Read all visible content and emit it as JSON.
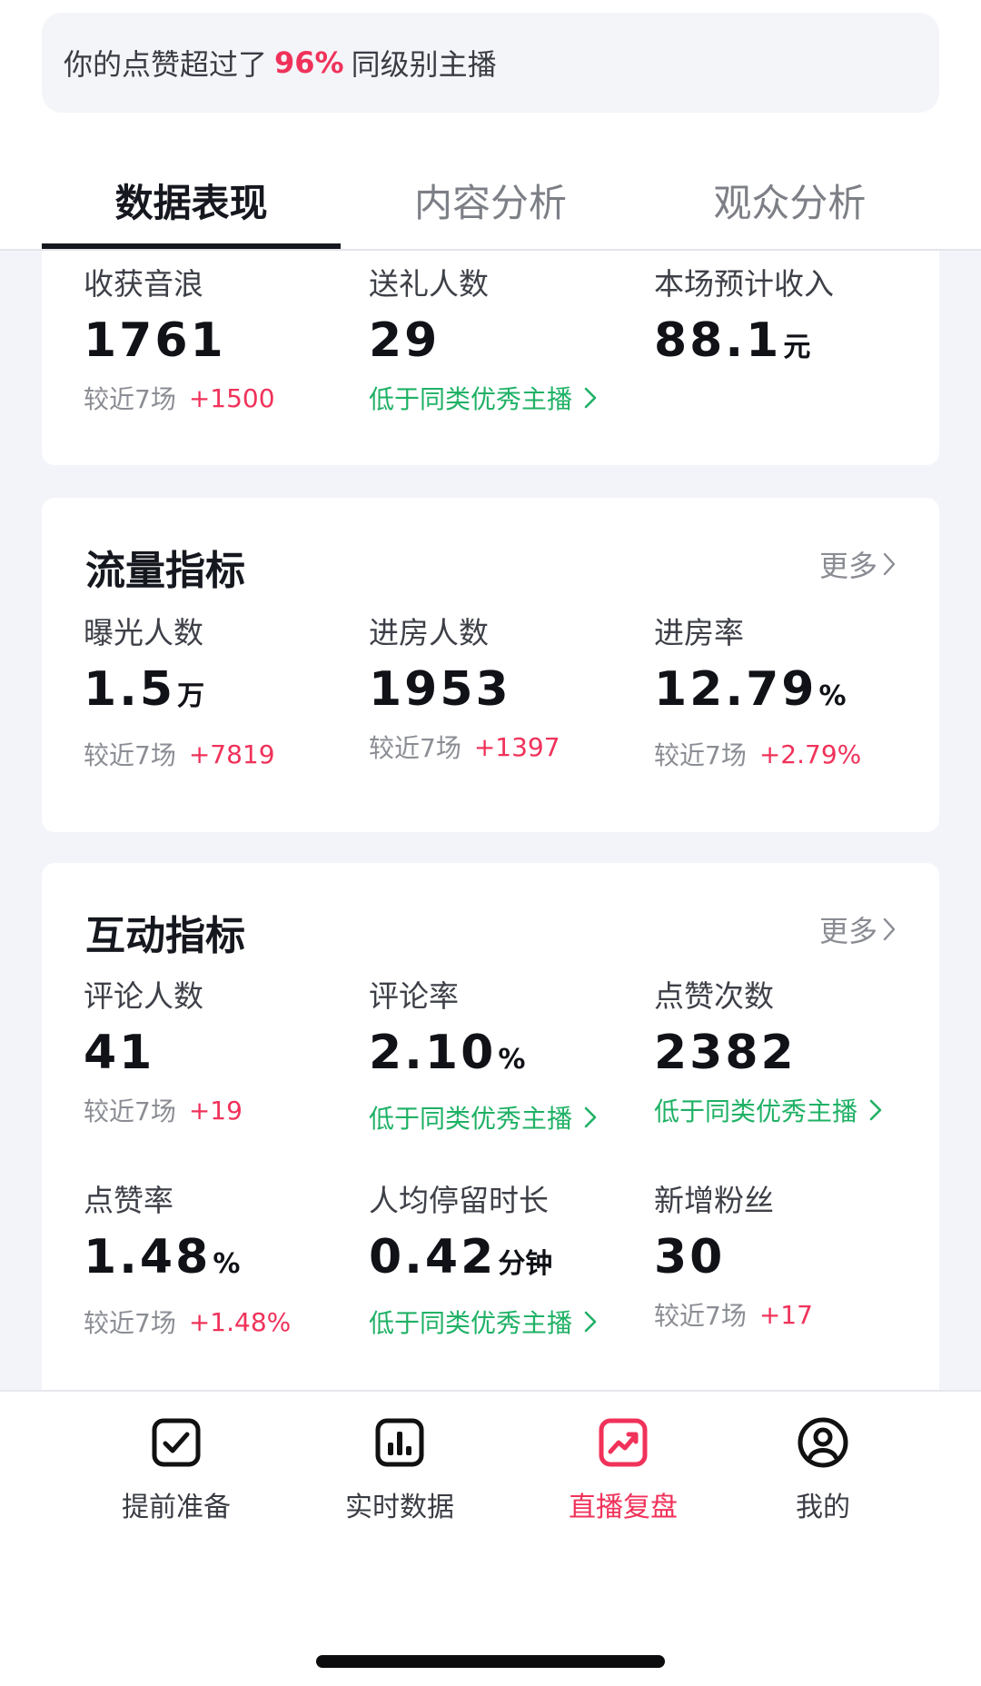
{
  "banner": {
    "prefix": "你的点赞超过了",
    "percent": "96%",
    "suffix": "同级别主播"
  },
  "tabs": [
    {
      "label": "数据表现",
      "active": true
    },
    {
      "label": "内容分析",
      "active": false
    },
    {
      "label": "观众分析",
      "active": false
    }
  ],
  "revenue": {
    "sound_waves": {
      "label": "收获音浪",
      "value": "1761",
      "compare": "较近7场",
      "delta": "+1500"
    },
    "gift_givers": {
      "label": "送礼人数",
      "value": "29",
      "hint": "低于同类优秀主播"
    },
    "income": {
      "label": "本场预计收入",
      "value": "88.1",
      "unit": "元"
    }
  },
  "traffic": {
    "title": "流量指标",
    "more": "更多",
    "impressions": {
      "label": "曝光人数",
      "value": "1.5",
      "unit": "万",
      "compare": "较近7场",
      "delta": "+7819"
    },
    "entries": {
      "label": "进房人数",
      "value": "1953",
      "compare": "较近7场",
      "delta": "+1397"
    },
    "entry_rate": {
      "label": "进房率",
      "value": "12.79",
      "unit": "%",
      "compare": "较近7场",
      "delta": "+2.79%"
    }
  },
  "interaction": {
    "title": "互动指标",
    "more": "更多",
    "commenters": {
      "label": "评论人数",
      "value": "41",
      "compare": "较近7场",
      "delta": "+19"
    },
    "comment_rate": {
      "label": "评论率",
      "value": "2.10",
      "unit": "%",
      "hint": "低于同类优秀主播"
    },
    "likes": {
      "label": "点赞次数",
      "value": "2382",
      "hint": "低于同类优秀主播"
    },
    "like_rate": {
      "label": "点赞率",
      "value": "1.48",
      "unit": "%",
      "compare": "较近7场",
      "delta": "+1.48%"
    },
    "avg_stay": {
      "label": "人均停留时长",
      "value": "0.42",
      "unit": "分钟",
      "hint": "低于同类优秀主播"
    },
    "new_fans": {
      "label": "新增粉丝",
      "value": "30",
      "compare": "较近7场",
      "delta": "+17"
    }
  },
  "bottom_nav": [
    {
      "label": "提前准备",
      "icon": "checkbox-icon",
      "active": false
    },
    {
      "label": "实时数据",
      "icon": "bar-chart-icon",
      "active": false
    },
    {
      "label": "直播复盘",
      "icon": "trend-chart-icon",
      "active": true
    },
    {
      "label": "我的",
      "icon": "user-icon",
      "active": false
    }
  ],
  "colors": {
    "accent": "#f0325a",
    "positive_hint": "#1fb165",
    "text": "#16181f",
    "page_bg": "#f3f4f9"
  }
}
